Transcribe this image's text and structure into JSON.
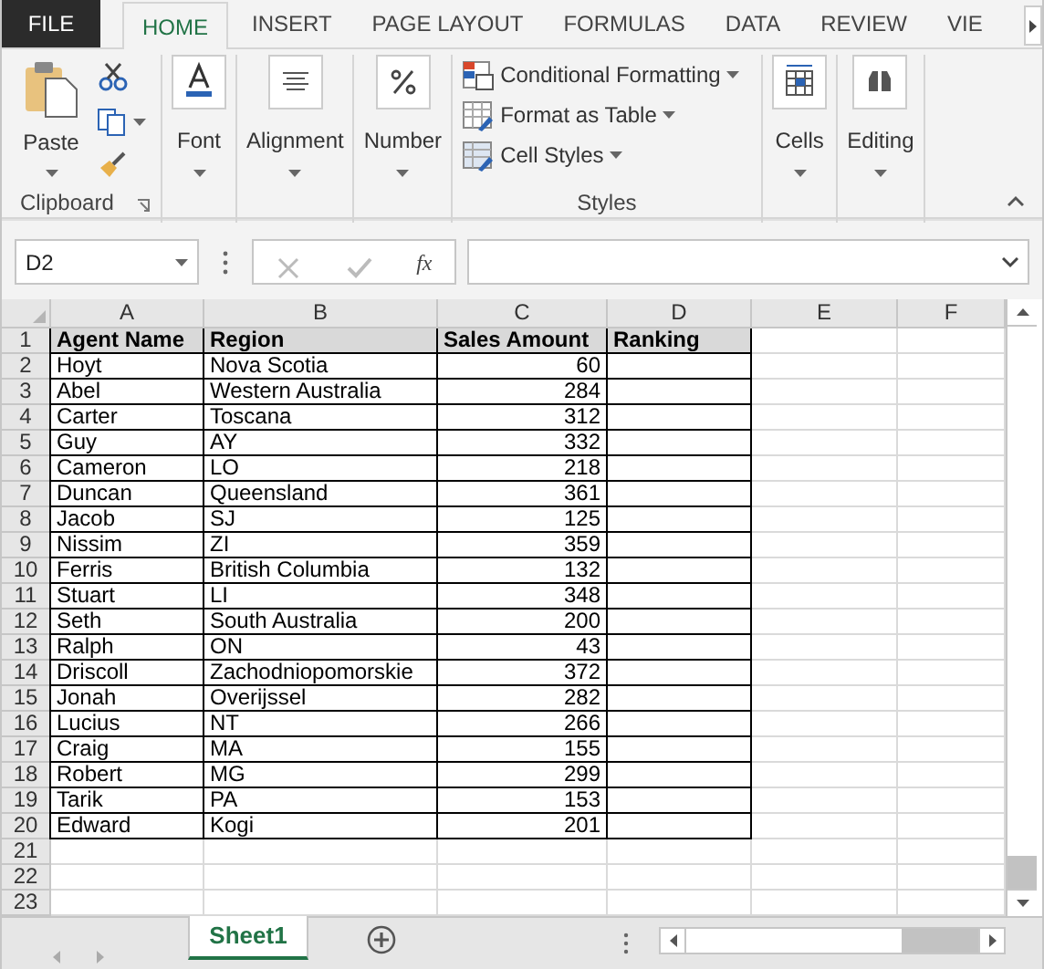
{
  "tabs": [
    {
      "label": "FILE",
      "kind": "file",
      "selected": false
    },
    {
      "label": "HOME",
      "kind": "tab",
      "selected": true
    },
    {
      "label": "INSERT",
      "kind": "tab",
      "selected": false
    },
    {
      "label": "PAGE LAYOUT",
      "kind": "tab",
      "selected": false
    },
    {
      "label": "FORMULAS",
      "kind": "tab",
      "selected": false
    },
    {
      "label": "DATA",
      "kind": "tab",
      "selected": false
    },
    {
      "label": "REVIEW",
      "kind": "tab",
      "selected": false
    },
    {
      "label": "VIE",
      "kind": "tab",
      "selected": false
    }
  ],
  "ribbon": {
    "groups": [
      {
        "kind": "clipboard",
        "button": "Paste",
        "label": "Clipboard"
      },
      {
        "kind": "dropdown",
        "button": "Font"
      },
      {
        "kind": "dropdown",
        "button": "Alignment"
      },
      {
        "kind": "dropdown",
        "button": "Number"
      },
      {
        "kind": "styles",
        "items": [
          "Conditional Formatting",
          "Format as Table",
          "Cell Styles"
        ],
        "label": "Styles"
      },
      {
        "kind": "dropdown",
        "button": "Cells"
      },
      {
        "kind": "dropdown",
        "button": "Editing"
      }
    ]
  },
  "formula_bar": {
    "name_box": "D2",
    "function_label": "fx"
  },
  "sheet": {
    "columns": [
      "A",
      "B",
      "C",
      "D",
      "E",
      "F"
    ],
    "row_numbers": [
      "1",
      "2",
      "3",
      "4",
      "5",
      "6",
      "7",
      "8",
      "9",
      "10",
      "11",
      "12",
      "13",
      "14",
      "15",
      "16",
      "17",
      "18",
      "19",
      "20",
      "21",
      "22",
      "23"
    ],
    "rows": [
      [
        "Agent Name",
        "Region",
        "Sales Amount",
        "Ranking"
      ],
      [
        "Hoyt",
        "Nova Scotia",
        "60",
        ""
      ],
      [
        "Abel",
        "Western Australia",
        "284",
        ""
      ],
      [
        "Carter",
        "Toscana",
        "312",
        ""
      ],
      [
        "Guy",
        "AY",
        "332",
        ""
      ],
      [
        "Cameron",
        "LO",
        "218",
        ""
      ],
      [
        "Duncan",
        "Queensland",
        "361",
        ""
      ],
      [
        "Jacob",
        "SJ",
        "125",
        ""
      ],
      [
        "Nissim",
        "ZI",
        "359",
        ""
      ],
      [
        "Ferris",
        "British Columbia",
        "132",
        ""
      ],
      [
        "Stuart",
        "LI",
        "348",
        ""
      ],
      [
        "Seth",
        "South Australia",
        "200",
        ""
      ],
      [
        "Ralph",
        "ON",
        "43",
        ""
      ],
      [
        "Driscoll",
        "Zachodniopomorskie",
        "372",
        ""
      ],
      [
        "Jonah",
        "Overijssel",
        "282",
        ""
      ],
      [
        "Lucius",
        "NT",
        "266",
        ""
      ],
      [
        "Craig",
        "MA",
        "155",
        ""
      ],
      [
        "Robert",
        "MG",
        "299",
        ""
      ],
      [
        "Tarik",
        "PA",
        "153",
        ""
      ],
      [
        "Edward",
        "Kogi",
        "201",
        ""
      ]
    ]
  },
  "sheet_tabs": [
    {
      "label": "Sheet1",
      "selected": true
    }
  ]
}
